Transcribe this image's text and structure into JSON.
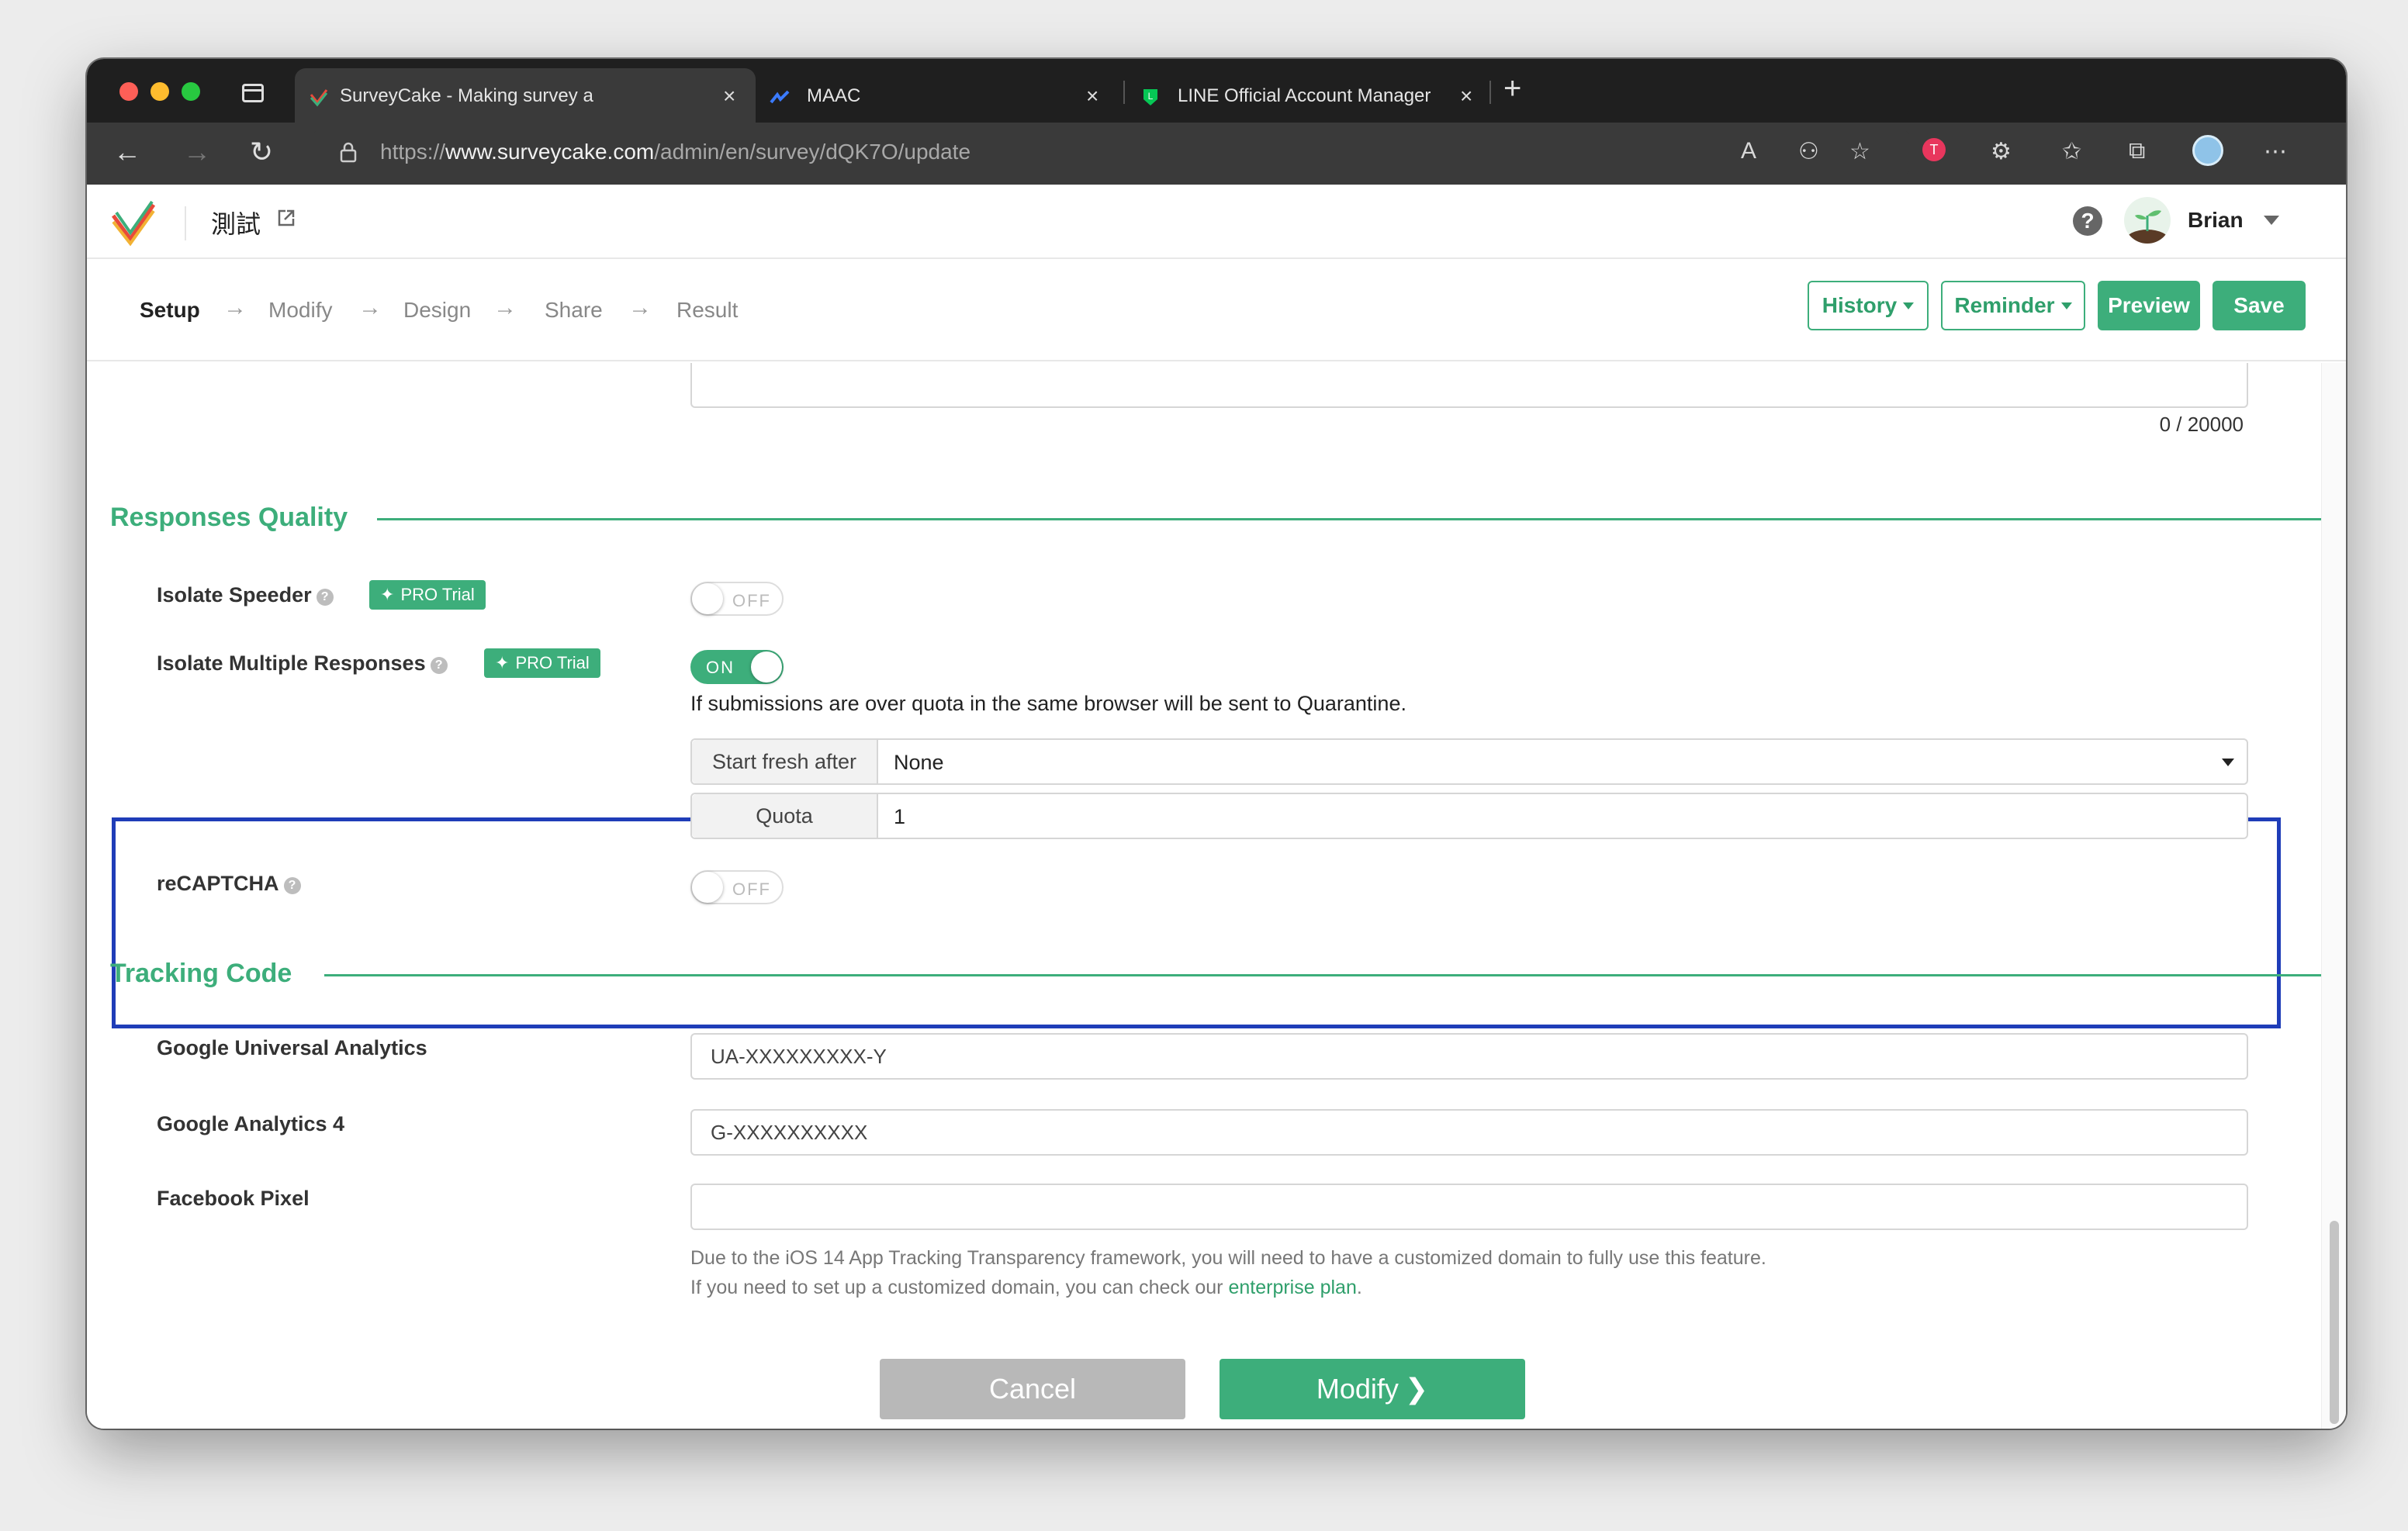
{
  "browser": {
    "tabs": [
      {
        "title": "SurveyCake - Making survey a",
        "active": true
      },
      {
        "title": "MAAC",
        "active": false
      },
      {
        "title": "LINE Official Account Manager",
        "active": false
      }
    ],
    "url_prefix": "https://",
    "url_host": "www.surveycake.com",
    "url_path": "/admin/en/survey/dQK7O/update"
  },
  "header": {
    "survey_title": "測試",
    "user_name": "Brian"
  },
  "steps": [
    {
      "label": "Setup",
      "current": true
    },
    {
      "label": "Modify",
      "current": false
    },
    {
      "label": "Design",
      "current": false
    },
    {
      "label": "Share",
      "current": false
    },
    {
      "label": "Result",
      "current": false
    }
  ],
  "actions": {
    "history": "History",
    "reminder": "Reminder",
    "preview": "Preview",
    "save": "Save"
  },
  "char_count": "0 / 20000",
  "responses_quality": {
    "title": "Responses Quality",
    "isolate_speeder": {
      "label": "Isolate Speeder",
      "badge": "PRO Trial",
      "state": "OFF"
    },
    "isolate_multiple": {
      "label": "Isolate Multiple Responses",
      "badge": "PRO Trial",
      "state": "ON",
      "description": "If submissions are over quota in the same browser will be sent to Quarantine.",
      "start_fresh_label": "Start fresh after",
      "start_fresh_value": "None",
      "quota_label": "Quota",
      "quota_value": "1"
    },
    "recaptcha": {
      "label": "reCAPTCHA",
      "state": "OFF"
    }
  },
  "tracking_code": {
    "title": "Tracking Code",
    "ua": {
      "label": "Google Universal Analytics",
      "value": "UA-XXXXXXXXX-Y"
    },
    "ga4": {
      "label": "Google Analytics 4",
      "value": "G-XXXXXXXXXX"
    },
    "fb": {
      "label": "Facebook Pixel",
      "value": ""
    },
    "note_line1": "Due to the iOS 14 App Tracking Transparency framework, you will need to have a customized domain to fully use this feature.",
    "note_line2_prefix": "If you need to set up a customized domain, you can check our ",
    "note_link": "enterprise plan",
    "note_line2_suffix": "."
  },
  "footer": {
    "cancel": "Cancel",
    "modify": "Modify"
  },
  "colors": {
    "brand_green": "#3dae7b",
    "highlight_blue": "#1f3db8"
  }
}
